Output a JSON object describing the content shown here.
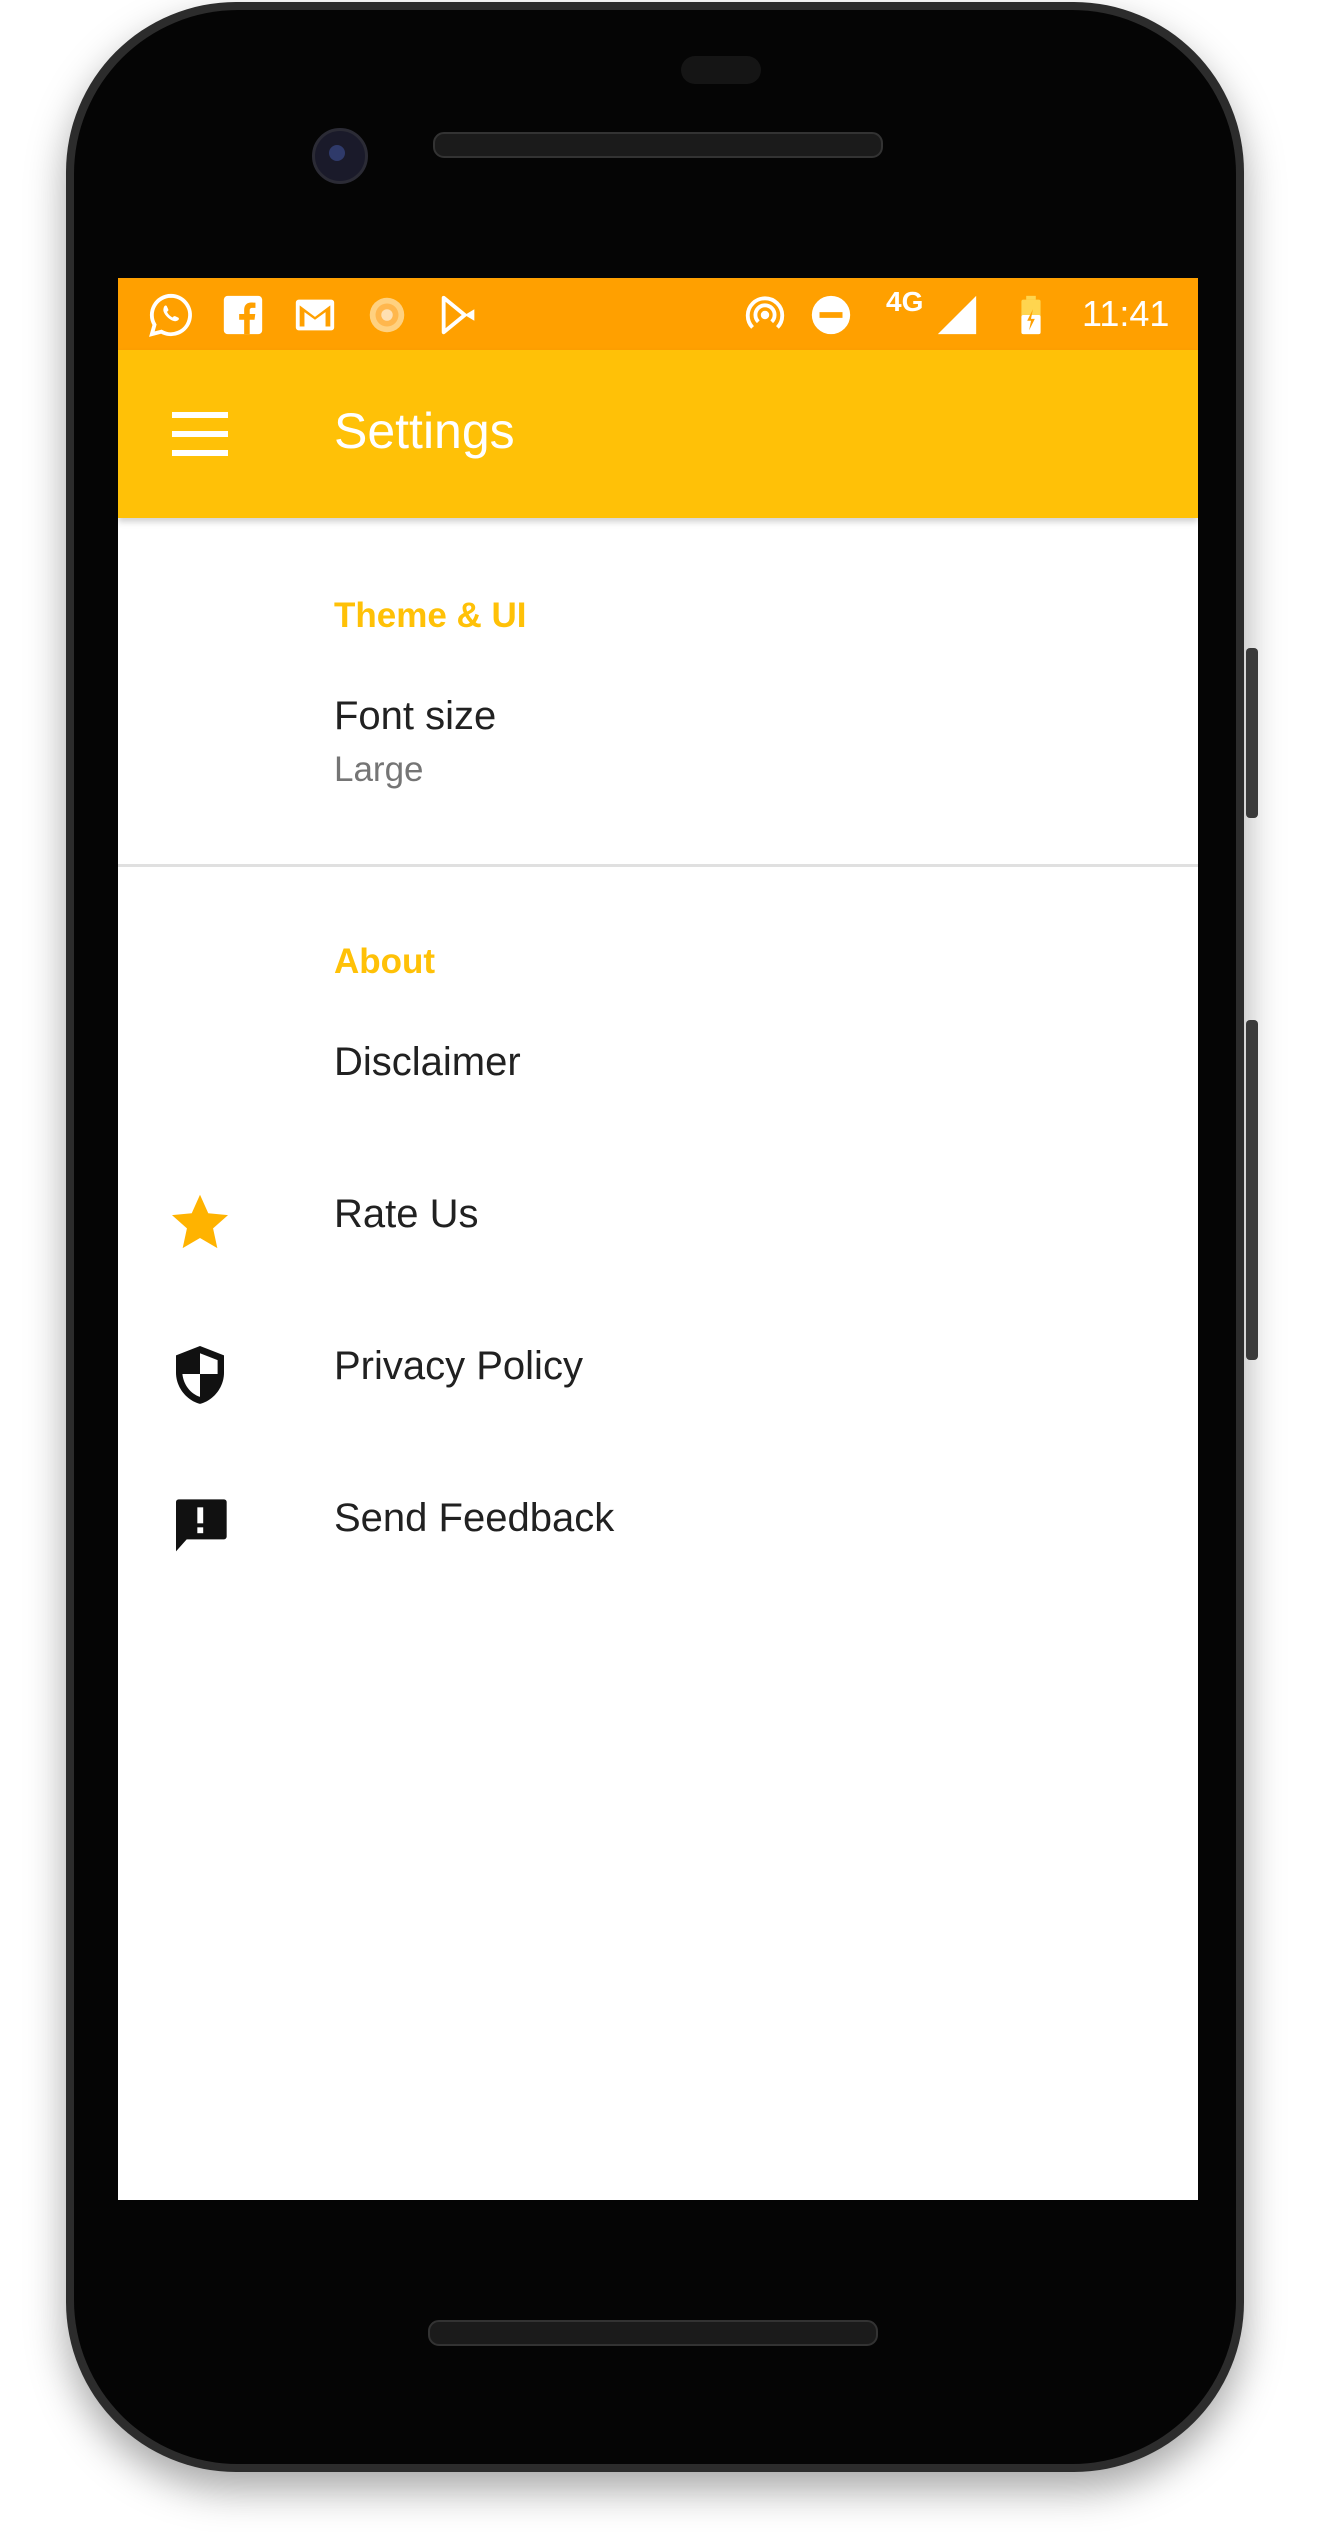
{
  "status_bar": {
    "left_icons": [
      "whatsapp-icon",
      "facebook-icon",
      "gmail-icon",
      "app-sun-icon",
      "play-store-icon"
    ],
    "right_icons": [
      "hotspot-icon",
      "do-not-disturb-icon",
      "signal-icon",
      "battery-charging-icon"
    ],
    "network": "4G",
    "time": "11:41"
  },
  "toolbar": {
    "menu_icon": "hamburger-menu-icon",
    "title": "Settings"
  },
  "sections": {
    "theme": {
      "header": "Theme & UI",
      "font_size": {
        "title": "Font size",
        "summary": "Large"
      }
    },
    "about": {
      "header": "About",
      "disclaimer": {
        "title": "Disclaimer"
      },
      "rate_us": {
        "title": "Rate Us",
        "icon": "star-icon"
      },
      "privacy_policy": {
        "title": "Privacy Policy",
        "icon": "shield-icon"
      },
      "send_feedback": {
        "title": "Send Feedback",
        "icon": "feedback-icon"
      }
    }
  },
  "colors": {
    "status_bar": "#ffa000",
    "toolbar": "#ffc107",
    "accent": "#ffc107",
    "star": "#ffb300"
  }
}
